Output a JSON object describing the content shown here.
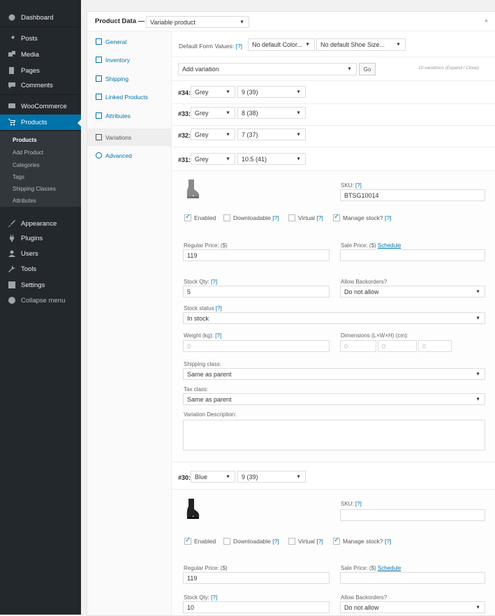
{
  "sidebar": {
    "items": [
      {
        "label": "Dashboard",
        "icon": "dashboard-icon"
      },
      {
        "label": "Posts",
        "icon": "pin-icon"
      },
      {
        "label": "Media",
        "icon": "media-icon"
      },
      {
        "label": "Pages",
        "icon": "pages-icon"
      },
      {
        "label": "Comments",
        "icon": "comments-icon"
      },
      {
        "label": "WooCommerce",
        "icon": "woocommerce-icon"
      },
      {
        "label": "Products",
        "icon": "cart-icon"
      },
      {
        "label": "Appearance",
        "icon": "brush-icon"
      },
      {
        "label": "Plugins",
        "icon": "plugin-icon"
      },
      {
        "label": "Users",
        "icon": "users-icon"
      },
      {
        "label": "Tools",
        "icon": "wrench-icon"
      },
      {
        "label": "Settings",
        "icon": "settings-icon"
      },
      {
        "label": "Collapse menu",
        "icon": "collapse-icon"
      }
    ],
    "submenu": [
      "Products",
      "Add Product",
      "Categories",
      "Tags",
      "Shipping Classes",
      "Attributes"
    ]
  },
  "panel": {
    "title": "Product Data —",
    "product_type": "Variable product",
    "tabs": [
      "General",
      "Inventory",
      "Shipping",
      "Linked Products",
      "Attributes",
      "Variations",
      "Advanced"
    ],
    "default_form_label": "Default Form Values:",
    "help": "[?]",
    "default_color": "No default Color...",
    "default_size": "No default Shoe Size...",
    "add_variation": "Add variation",
    "go": "Go",
    "variation_count": "10 variations (Expand / Close)"
  },
  "variations": [
    {
      "id": "#34:",
      "color": "Grey",
      "size": "9 (39)"
    },
    {
      "id": "#33:",
      "color": "Grey",
      "size": "8 (38)"
    },
    {
      "id": "#32:",
      "color": "Grey",
      "size": "7 (37)"
    },
    {
      "id": "#31:",
      "color": "Grey",
      "size": "10.5 (41)"
    },
    {
      "id": "#30:",
      "color": "Blue",
      "size": "9 (39)"
    }
  ],
  "detail1": {
    "sku_label": "SKU:",
    "sku": "BTSG10014",
    "enabled": "Enabled",
    "downloadable": "Downloadable",
    "virtual": "Virtual",
    "manage_stock": "Manage stock?",
    "regular_price_label": "Regular Price: ($)",
    "regular_price": "119",
    "sale_price_label": "Sale Price: ($)",
    "schedule": "Schedule",
    "stock_qty_label": "Stock Qty:",
    "stock_qty": "5",
    "backorders_label": "Allow Backorders?",
    "backorders": "Do not allow",
    "stock_status_label": "Stock status",
    "stock_status": "In stock",
    "weight_label": "Weight (kg):",
    "weight": "0",
    "dimensions_label": "Dimensions (L×W×H) (cm):",
    "dim_l": "0",
    "dim_w": "0",
    "dim_h": "0",
    "shipping_class_label": "Shipping class:",
    "shipping_class": "Same as parent",
    "tax_class_label": "Tax class:",
    "tax_class": "Same as parent",
    "description_label": "Variation Description:"
  },
  "detail2": {
    "sku_label": "SKU:",
    "enabled": "Enabled",
    "downloadable": "Downloadable",
    "virtual": "Virtual",
    "manage_stock": "Manage stock?",
    "regular_price_label": "Regular Price: ($)",
    "regular_price": "119",
    "sale_price_label": "Sale Price: ($)",
    "schedule": "Schedule",
    "stock_qty_label": "Stock Qty:",
    "stock_qty": "10",
    "backorders_label": "Allow Backorders?",
    "backorders": "Do not allow"
  },
  "colors": {
    "sidebar": "#23282d",
    "accent": "#0073aa",
    "link": "#0073aa"
  }
}
